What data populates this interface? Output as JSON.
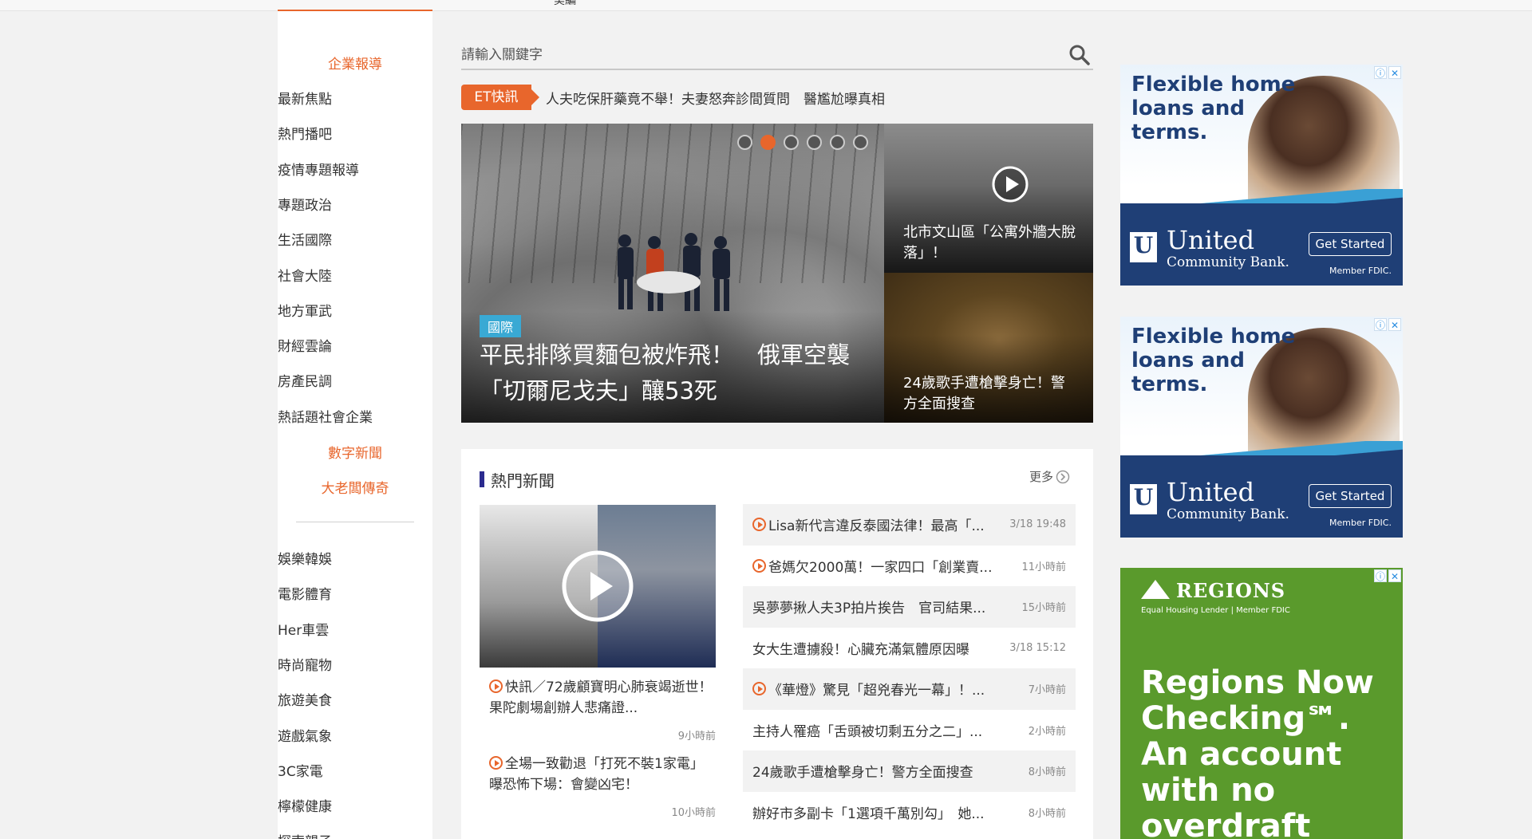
{
  "top_nav": {
    "clipped_label": "美編"
  },
  "sidebar": {
    "top_links": [
      "企業報導"
    ],
    "rows": [
      {
        "l": "最新",
        "r": "焦點",
        "lc": "orange",
        "rc": "orange"
      },
      {
        "l": "熱門",
        "r": "播吧",
        "lc": "orange",
        "rc": "orange"
      },
      {
        "l": "疫情",
        "r": "專題報導",
        "lc": "blue",
        "rc": "orange"
      },
      {
        "l": "專題",
        "r": "政治",
        "lc": "",
        "rc": ""
      },
      {
        "l": "生活",
        "r": "國際",
        "lc": "",
        "rc": ""
      },
      {
        "l": "社會",
        "r": "大陸",
        "lc": "",
        "rc": ""
      },
      {
        "l": "地方",
        "r": "軍武",
        "lc": "",
        "rc": ""
      },
      {
        "l": "財經",
        "r": "雲論",
        "lc": "",
        "rc": ""
      },
      {
        "l": "房產",
        "r": "民調",
        "lc": "",
        "rc": ""
      },
      {
        "l": "熱話題",
        "r": "社會企業",
        "lc": "",
        "rc": ""
      }
    ],
    "special_1": "數字新聞",
    "special_2": "大老闆傳奇",
    "rows2": [
      {
        "l": "娛樂",
        "r": "韓娛",
        "lc": "",
        "rc": ""
      },
      {
        "l": "電影",
        "r": "體育",
        "lc": "",
        "rc": ""
      },
      {
        "l": "Her",
        "r": "車雲",
        "lc": "pink",
        "rc": ""
      },
      {
        "l": "時尚",
        "r": "寵物",
        "lc": "",
        "rc": ""
      },
      {
        "l": "旅遊",
        "r": "美食",
        "lc": "",
        "rc": ""
      },
      {
        "l": "遊戲",
        "r": "氣象",
        "lc": "",
        "rc": ""
      },
      {
        "l": "3C",
        "r": "家電",
        "lc": "",
        "rc": ""
      },
      {
        "l": "檸檬",
        "r": "健康",
        "lc": "",
        "rc": ""
      },
      {
        "l": "探索",
        "r": "親子",
        "lc": "",
        "rc": ""
      }
    ]
  },
  "search": {
    "placeholder": "請輸入關鍵字"
  },
  "flash": {
    "badge": "ET快訊",
    "text": "人夫吃保肝藥竟不舉！夫妻怒奔診間質問　醫尷尬曝真相"
  },
  "hero": {
    "tag": "國際",
    "title": "平民排隊買麵包被炸飛！　俄軍空襲「切爾尼戈夫」釀53死",
    "side_1": "北市文山區「公寓外牆大脫落」！",
    "side_2": "24歲歌手遭槍擊身亡！警方全面搜查"
  },
  "hot_news": {
    "title": "熱門新聞",
    "more": "更多",
    "videos": [
      {
        "title": "快訊／72歲顧寶明心肺衰竭逝世！果陀劇場創辦人悲痛證...",
        "time": "9小時前"
      },
      {
        "title": "全場一致勸退「打死不裝1家電」　曝恐怖下場：會變凶宅！",
        "time": "10小時前"
      }
    ],
    "list": [
      {
        "title": "Lisa新代言違反泰國法律！最高「...",
        "time": "3/18 19:48",
        "video": true
      },
      {
        "title": "爸媽欠2000萬！一家四口「創業賣...",
        "time": "11小時前",
        "video": true
      },
      {
        "title": "吳夢夢揪人夫3P拍片挨告　官司結果...",
        "time": "15小時前",
        "video": false
      },
      {
        "title": "女大生遭擄殺！心臟充滿氣體原因曝",
        "time": "3/18 15:12",
        "video": false
      },
      {
        "title": "《華燈》驚見「超兇春光一幕」！...",
        "time": "7小時前",
        "video": true
      },
      {
        "title": "主持人罹癌「舌頭被切剩五分之二」...",
        "time": "2小時前",
        "video": false
      },
      {
        "title": "24歲歌手遭槍擊身亡！警方全面搜查",
        "time": "8小時前",
        "video": false
      },
      {
        "title": "辦好市多副卡「1選項千萬別勾」　她...",
        "time": "8小時前",
        "video": false
      }
    ]
  },
  "ads": {
    "uc": {
      "headline": "Flexible home loans and terms.",
      "bank": "United",
      "bank2": "Community Bank.",
      "cta": "Get Started",
      "fdic": "Member FDIC."
    },
    "regions": {
      "logo": "REGIONS",
      "sub": "Equal Housing Lender | Member FDIC",
      "headline": "Regions Now Checking℠. An account with no overdraft fees."
    }
  },
  "colors": {
    "accent": "#e8662c",
    "blue": "#3a3a8c",
    "pink": "#d45fd4",
    "ad_navy": "#1f3f76",
    "ad_green": "#5a9a2c"
  }
}
